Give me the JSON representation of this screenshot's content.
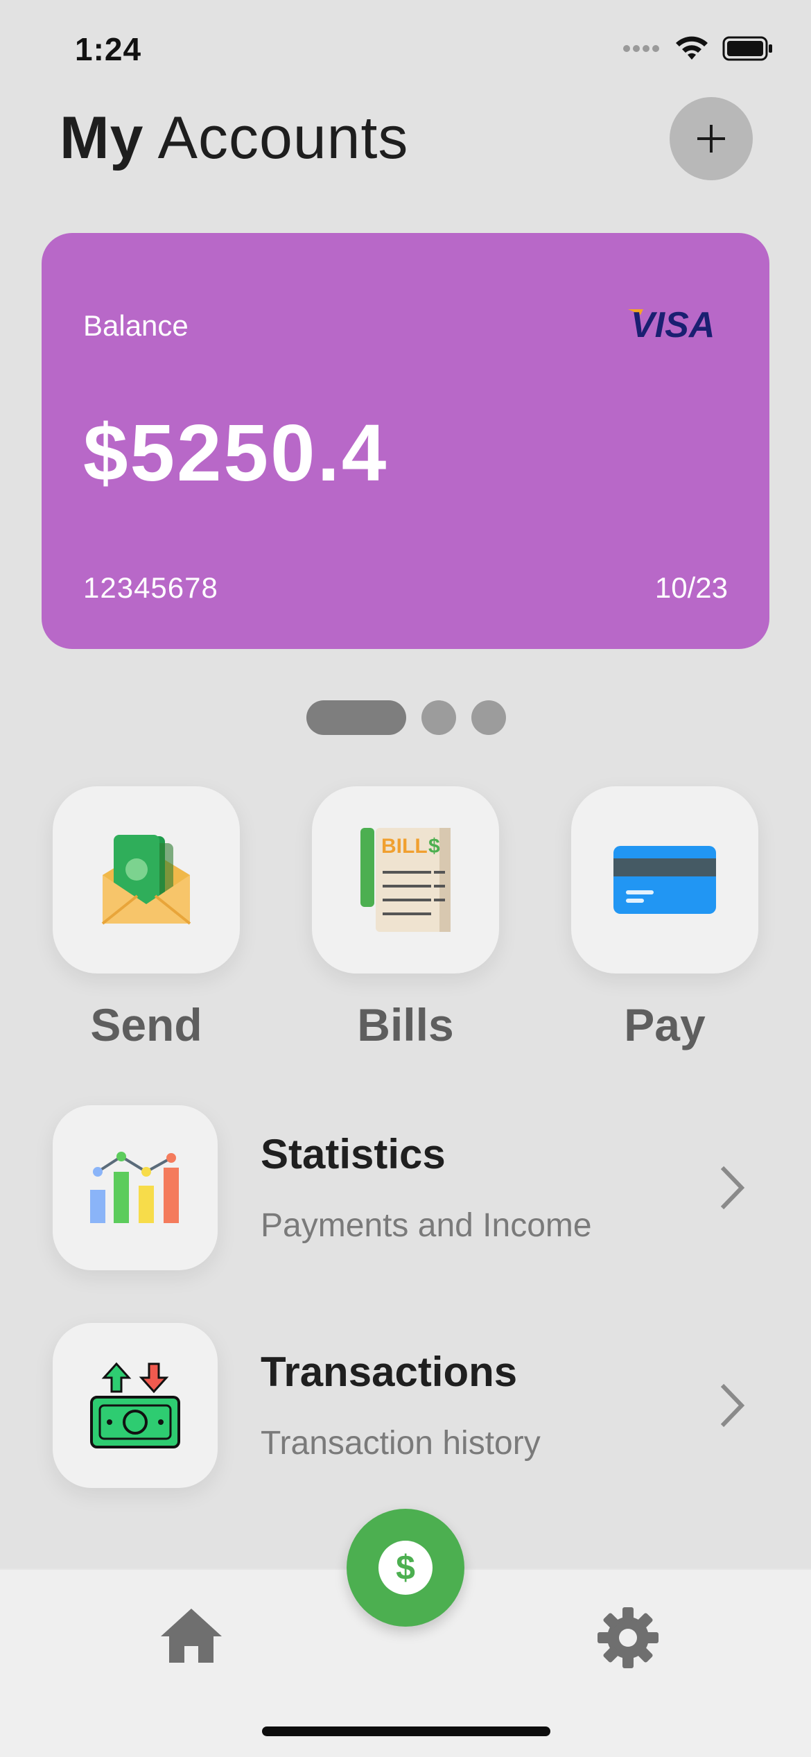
{
  "status_bar": {
    "time": "1:24",
    "icons": [
      "signal-dots-icon",
      "wifi-icon",
      "battery-icon"
    ]
  },
  "header": {
    "title_bold": "My",
    "title_light": "Accounts",
    "add_icon": "plus-icon"
  },
  "card": {
    "background": "#b868c8",
    "balance_label": "Balance",
    "balance_value": "$5250.4",
    "brand": "VISA",
    "number": "12345678",
    "expiry": "10/23"
  },
  "pager": {
    "count": 3,
    "active": 0
  },
  "actions": [
    {
      "label": "Send",
      "icon": "money-envelope-icon"
    },
    {
      "label": "Bills",
      "icon": "bill-receipt-icon"
    },
    {
      "label": "Pay",
      "icon": "credit-card-icon"
    }
  ],
  "list": [
    {
      "title": "Statistics",
      "subtitle": "Payments and Income",
      "icon": "bar-chart-icon"
    },
    {
      "title": "Transactions",
      "subtitle": "Transaction history",
      "icon": "money-transfer-icon"
    }
  ],
  "bottom_nav": {
    "left_icon": "home-icon",
    "center_icon": "dollar-icon",
    "right_icon": "gear-icon",
    "accent": "#4caf50"
  }
}
